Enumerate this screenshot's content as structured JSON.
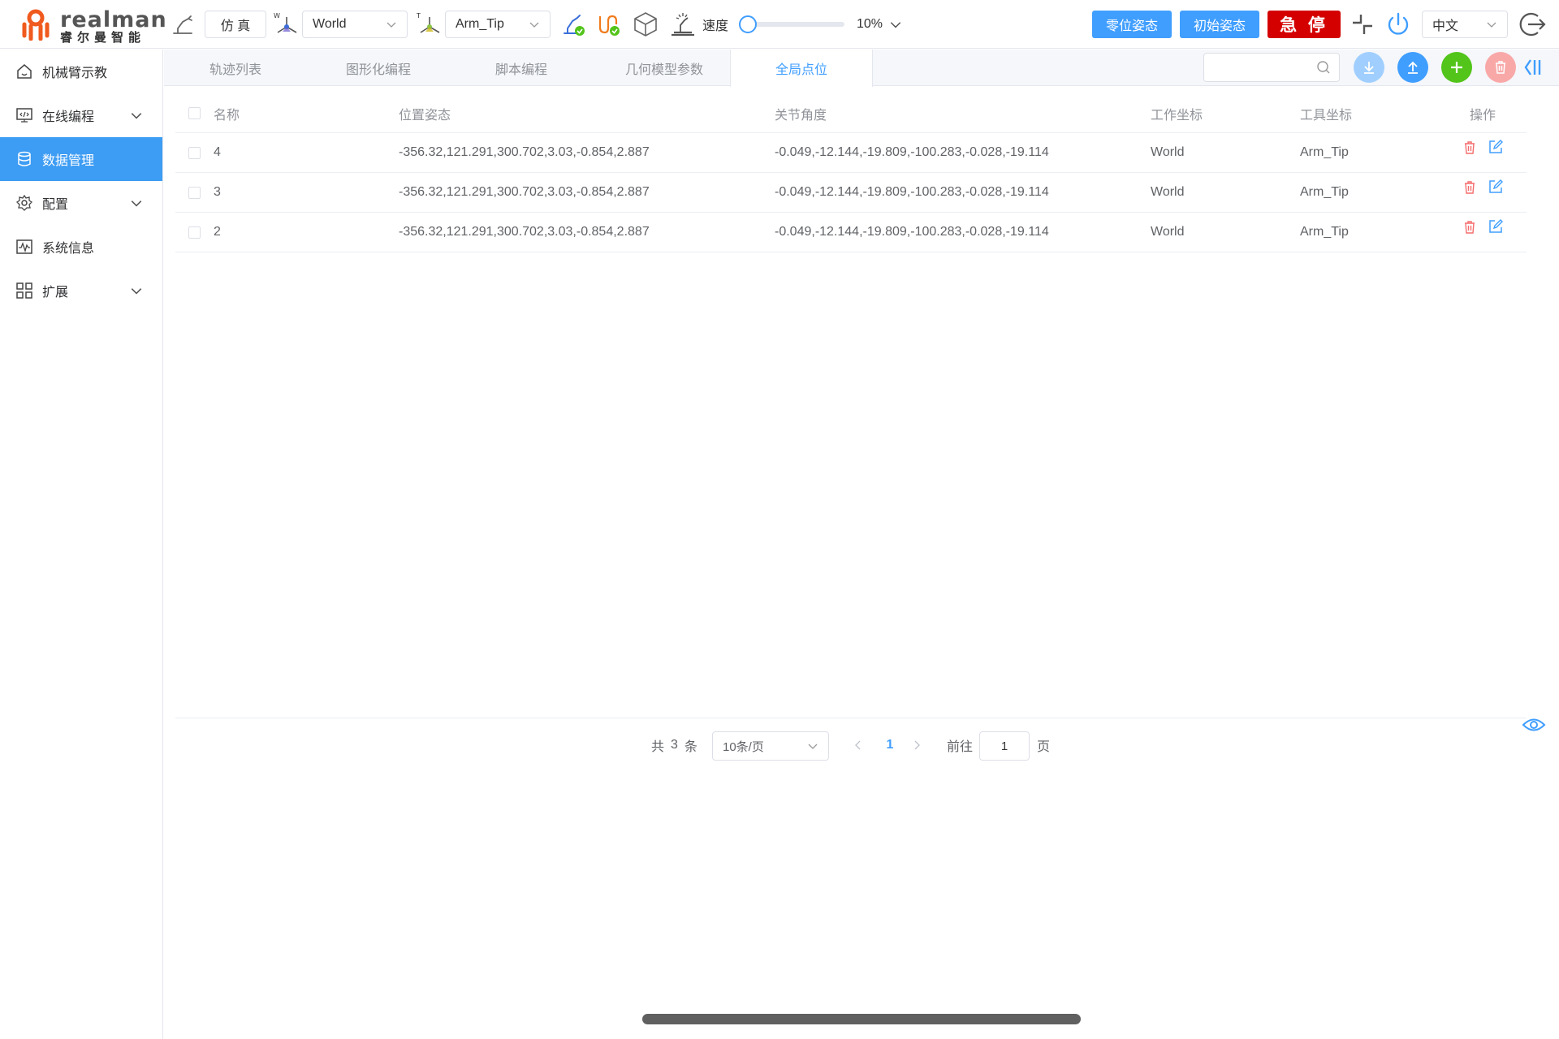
{
  "app": {
    "brand": "realman",
    "brand_sub": "睿尔曼智能"
  },
  "toolbar": {
    "sim_label": "仿 真",
    "work_coord": "World",
    "tool_coord": "Arm_Tip",
    "speed_label": "速度",
    "speed_value": "10%",
    "speed_fraction": 0.0,
    "zero_pose_label": "零位姿态",
    "init_pose_label": "初始姿态",
    "estop_label": "急 停",
    "language": "中文",
    "colors": {
      "accent": "#409eff",
      "estop": "#d40000",
      "sidebar_active": "#3d9cf3",
      "green": "#52c41a",
      "danger_light": "#f9a8a8"
    }
  },
  "sidebar": {
    "items": [
      {
        "label": "机械臂示教",
        "icon": "home-icon",
        "expandable": false,
        "active": false
      },
      {
        "label": "在线编程",
        "icon": "code-monitor-icon",
        "expandable": true,
        "active": false
      },
      {
        "label": "数据管理",
        "icon": "database-icon",
        "expandable": false,
        "active": true
      },
      {
        "label": "配置",
        "icon": "gear-icon",
        "expandable": true,
        "active": false
      },
      {
        "label": "系统信息",
        "icon": "waveform-icon",
        "expandable": false,
        "active": false
      },
      {
        "label": "扩展",
        "icon": "grid-icon",
        "expandable": true,
        "active": false
      }
    ]
  },
  "tabs": [
    {
      "label": "轨迹列表",
      "active": false
    },
    {
      "label": "图形化编程",
      "active": false
    },
    {
      "label": "脚本编程",
      "active": false
    },
    {
      "label": "几何模型参数",
      "active": false
    },
    {
      "label": "全局点位",
      "active": true
    }
  ],
  "search": {
    "placeholder": ""
  },
  "table": {
    "headers": {
      "name": "名称",
      "pose": "位置姿态",
      "joints": "关节角度",
      "work": "工作坐标",
      "tool": "工具坐标",
      "ops": "操作"
    },
    "rows": [
      {
        "name": "4",
        "pose": "-356.32,121.291,300.702,3.03,-0.854,2.887",
        "joints": "-0.049,-12.144,-19.809,-100.283,-0.028,-19.114",
        "work": "World",
        "tool": "Arm_Tip"
      },
      {
        "name": "3",
        "pose": "-356.32,121.291,300.702,3.03,-0.854,2.887",
        "joints": "-0.049,-12.144,-19.809,-100.283,-0.028,-19.114",
        "work": "World",
        "tool": "Arm_Tip"
      },
      {
        "name": "2",
        "pose": "-356.32,121.291,300.702,3.03,-0.854,2.887",
        "joints": "-0.049,-12.144,-19.809,-100.283,-0.028,-19.114",
        "work": "World",
        "tool": "Arm_Tip"
      }
    ]
  },
  "pagination": {
    "total_prefix": "共",
    "total": "3",
    "total_suffix": "条",
    "page_size": "10条/页",
    "current_page": "1",
    "goto_label": "前往",
    "goto_value": "1",
    "page_suffix": "页"
  }
}
